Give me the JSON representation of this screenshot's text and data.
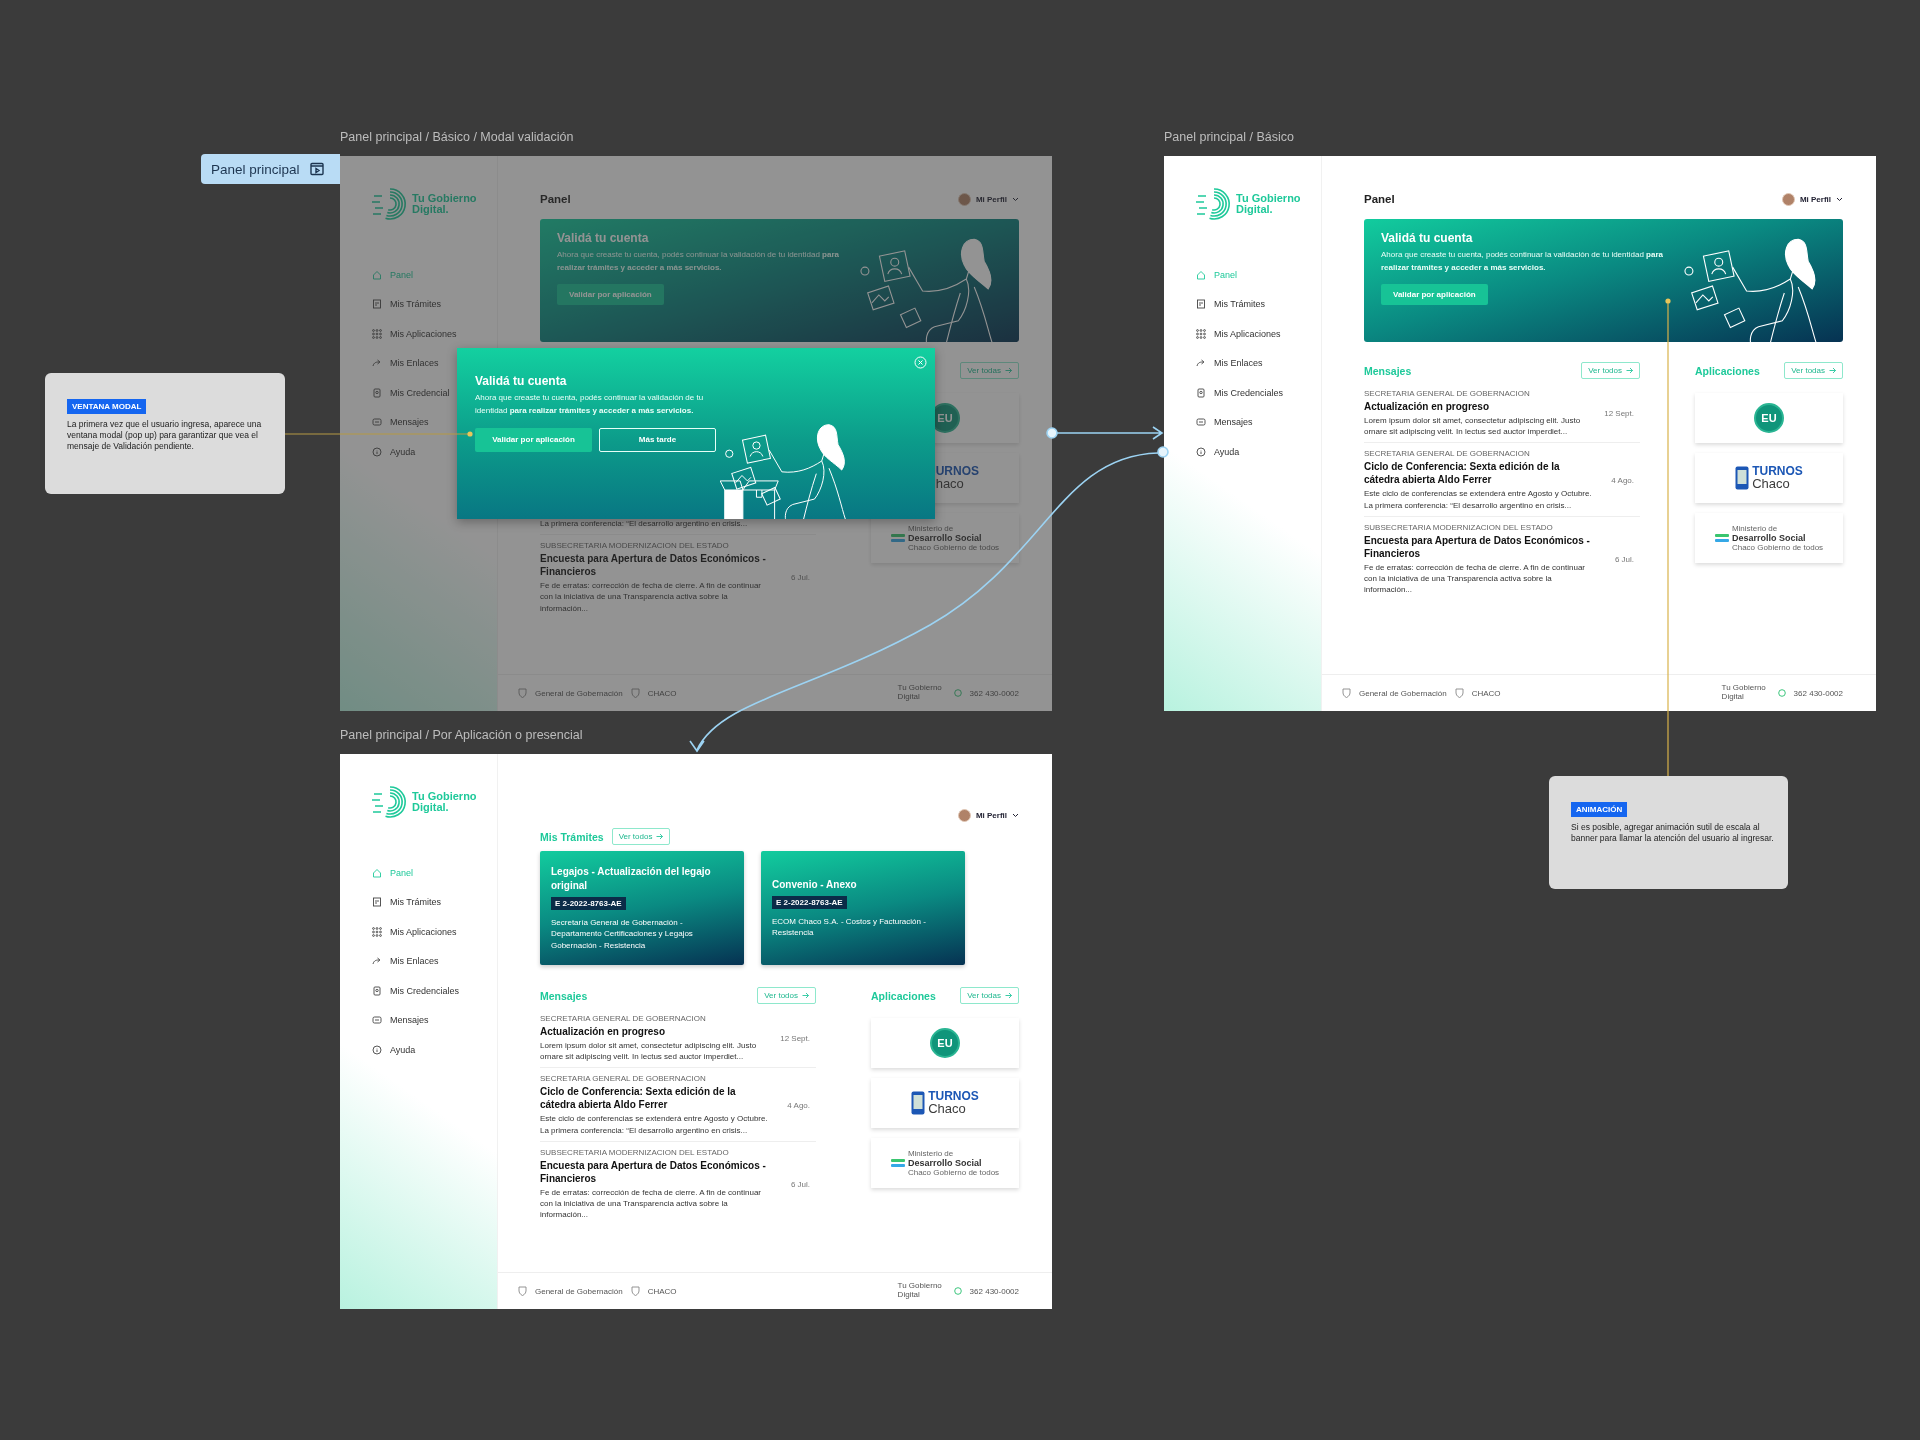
{
  "tag": {
    "label": "Panel principal"
  },
  "notes": [
    {
      "badge": "VENTANA MODAL",
      "text": "La primera vez que el usuario ingresa, aparece una ventana modal (pop up) para garantizar que vea el mensaje de Validación pendiente."
    },
    {
      "badge": "ANIMACIÓN",
      "text": "Si es posible, agregar animación sutil de escala al banner para llamar la atención del usuario al ingresar."
    }
  ],
  "frames": [
    {
      "kind": "modal",
      "label": "Panel principal / Básico / Modal validación",
      "brand": [
        "Tu Gobierno",
        "Digital."
      ],
      "nav": [
        {
          "label": "Panel",
          "selected": true
        },
        {
          "label": "Mis Trámites",
          "selected": false
        },
        {
          "label": "Mis Aplicaciones",
          "selected": false
        },
        {
          "label": "Mis Enlaces",
          "selected": false
        },
        {
          "label": "Mis Credencial",
          "selected": false
        },
        {
          "label": "Mensajes",
          "selected": false
        },
        {
          "label": "Ayuda",
          "selected": false
        }
      ],
      "title": "Panel",
      "profile": "Mi Perfil",
      "banner": {
        "title": "Validá tu cuenta",
        "text": "Ahora que creaste tu cuenta, podés continuar la validación de tu identidad **para realizar trámites y acceder a más servicios.**",
        "button": "Validar por aplicación"
      },
      "messages": {
        "items": [
          {
            "text": "La primera conferencia: “El desarrollo argentino en crisis..."
          },
          {
            "org": "SUBSECRETARIA MODERNIZACION DEL ESTADO",
            "title": "Encuesta para Apertura de Datos Económicos - Financieros",
            "text": "Fe de erratas: corrección de fecha de cierre. A fin de continuar con la iniciativa de una Transparencia activa sobre la información...",
            "date": "6 Jul."
          }
        ]
      },
      "apps": {
        "button": "Ver todas",
        "items": [
          {
            "kind": "eu",
            "text": "EU"
          },
          {
            "kind": "turnos_partial",
            "line1": "URNOS",
            "line2": "haco"
          },
          {
            "kind": "social",
            "small": "Ministerio de",
            "name": "Desarrollo Social",
            "tagline": "Chaco Gobierno de todos"
          }
        ]
      },
      "footer": {
        "items": [
          "General de Gobernación",
          "CHACO"
        ],
        "brand": "Tu Gobierno Digital",
        "phone": "362 430-0002"
      },
      "modal": {
        "title": "Validá tu cuenta",
        "text": "Ahora que creaste tu cuenta, podés continuar la validación de tu identidad **para realizar trámites y acceder a más servicios.**",
        "buttons": [
          {
            "label": "Validar por aplicación",
            "kind": "primary"
          },
          {
            "label": "Más tarde",
            "kind": "outline"
          }
        ]
      }
    },
    {
      "kind": "basic",
      "label": "Panel principal / Básico",
      "brand": [
        "Tu Gobierno",
        "Digital."
      ],
      "nav": [
        {
          "label": "Panel",
          "selected": true
        },
        {
          "label": "Mis Trámites",
          "selected": false
        },
        {
          "label": "Mis Aplicaciones",
          "selected": false
        },
        {
          "label": "Mis Enlaces",
          "selected": false
        },
        {
          "label": "Mis Credenciales",
          "selected": false
        },
        {
          "label": "Mensajes",
          "selected": false
        },
        {
          "label": "Ayuda",
          "selected": false
        }
      ],
      "title": "Panel",
      "profile": "Mi Perfil",
      "banner": {
        "title": "Validá tu cuenta",
        "text": "Ahora que creaste tu cuenta, podés continuar la validación de tu identidad **para realizar trámites y acceder a más servicios.**",
        "button": "Validar por aplicación"
      },
      "messages": {
        "title": "Mensajes",
        "button": "Ver todos",
        "items": [
          {
            "org": "SECRETARIA GENERAL DE GOBERNACION",
            "title": "Actualización en progreso",
            "text": "Lorem ipsum dolor sit amet, consectetur adipiscing elit. Justo ornare sit adipiscing velit. In lectus sed auctor imperdiet...",
            "date": "12 Sept."
          },
          {
            "org": "SECRETARIA GENERAL DE GOBERNACION",
            "title": "Ciclo de Conferencia: Sexta edición de la cátedra abierta Aldo Ferrer",
            "text": "Este ciclo de conferencias se extenderá entre Agosto y Octubre. La primera conferencia: “El desarrollo argentino en crisis...",
            "date": "4 Ago."
          },
          {
            "org": "SUBSECRETARIA MODERNIZACION DEL ESTADO",
            "title": "Encuesta para Apertura de Datos Económicos - Financieros",
            "text": "Fe de erratas: corrección de fecha de cierre. A fin de continuar con la iniciativa de una Transparencia activa sobre la información...",
            "date": "6 Jul."
          }
        ]
      },
      "apps": {
        "title": "Aplicaciones",
        "button": "Ver todas",
        "items": [
          {
            "kind": "eu",
            "text": "EU"
          },
          {
            "kind": "turnos",
            "line1": "TURNOS",
            "line2": "Chaco"
          },
          {
            "kind": "social",
            "small": "Ministerio de",
            "name": "Desarrollo Social",
            "tagline": "Chaco Gobierno de todos"
          }
        ]
      },
      "footer": {
        "items": [
          "General de Gobernación",
          "CHACO"
        ],
        "brand": "Tu Gobierno Digital",
        "phone": "362 430-0002"
      }
    },
    {
      "kind": "tramites",
      "label": "Panel principal / Por Aplicación o presencial",
      "brand": [
        "Tu Gobierno",
        "Digital."
      ],
      "nav": [
        {
          "label": "Panel",
          "selected": true
        },
        {
          "label": "Mis Trámites",
          "selected": false
        },
        {
          "label": "Mis Aplicaciones",
          "selected": false
        },
        {
          "label": "Mis Enlaces",
          "selected": false
        },
        {
          "label": "Mis Credenciales",
          "selected": false
        },
        {
          "label": "Mensajes",
          "selected": false
        },
        {
          "label": "Ayuda",
          "selected": false
        }
      ],
      "profile": "Mi Perfil",
      "tramites": {
        "title": "Mis Trámites",
        "button": "Ver todos",
        "cards": [
          {
            "title": "Legajos - Actualización del legajo original",
            "code": "E 2-2022-8763-AE",
            "text": "Secretaría General de Gobernación - Departamento Certificaciones y Legajos Gobernación - Resistencia"
          },
          {
            "title": "Convenio - Anexo",
            "code": "E 2-2022-8763-AE",
            "text": "ECOM Chaco S.A. - Costos y Facturación - Resistencia"
          }
        ]
      },
      "messages": {
        "title": "Mensajes",
        "button": "Ver todos",
        "items": [
          {
            "org": "SECRETARIA GENERAL DE GOBERNACION",
            "title": "Actualización en progreso",
            "text": "Lorem ipsum dolor sit amet, consectetur adipiscing elit. Justo ornare sit adipiscing velit. In lectus sed auctor imperdiet...",
            "date": "12 Sept."
          },
          {
            "org": "SECRETARIA GENERAL DE GOBERNACION",
            "title": "Ciclo de Conferencia: Sexta edición de la cátedra abierta Aldo Ferrer",
            "text": "Este ciclo de conferencias se extenderá entre Agosto y Octubre. La primera conferencia: “El desarrollo argentino en crisis...",
            "date": "4 Ago."
          },
          {
            "org": "SUBSECRETARIA MODERNIZACION DEL ESTADO",
            "title": "Encuesta para Apertura de Datos Económicos - Financieros",
            "text": "Fe de erratas: corrección de fecha de cierre. A fin de continuar con la iniciativa de una Transparencia activa sobre la información...",
            "date": "6 Jul."
          }
        ]
      },
      "apps": {
        "title": "Aplicaciones",
        "button": "Ver todas",
        "items": [
          {
            "kind": "eu",
            "text": "EU"
          },
          {
            "kind": "turnos",
            "line1": "TURNOS",
            "line2": "Chaco"
          },
          {
            "kind": "social",
            "small": "Ministerio de",
            "name": "Desarrollo Social",
            "tagline": "Chaco Gobierno de todos"
          }
        ]
      },
      "footer": {
        "items": [
          "General de Gobernación",
          "CHACO"
        ],
        "brand": "Tu Gobierno Digital",
        "phone": "362 430-0002"
      }
    }
  ]
}
